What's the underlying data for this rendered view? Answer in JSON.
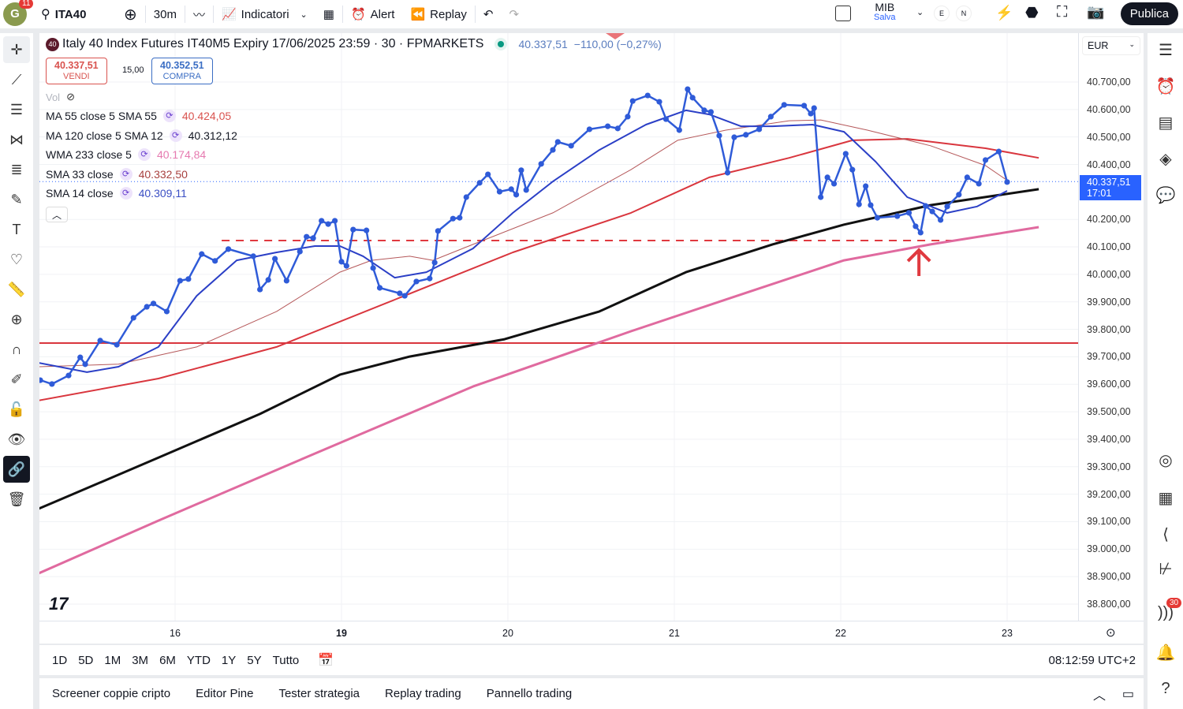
{
  "topbar": {
    "notifications": "11",
    "avatar_letter": "G",
    "symbol": "ITA40",
    "interval": "30m",
    "indicators": "Indicatori",
    "alert": "Alert",
    "replay": "Replay",
    "layout_name": "MIB",
    "layout_status": "Salva",
    "e_label": "E",
    "n_label": "N",
    "publish": "Publica"
  },
  "header": {
    "symbol_badge": "40",
    "title": "Italy 40 Index Futures IT40M5 Expiry 17/06/2025 23:59 · 30 · FPMARKETS",
    "last": "40.337,51",
    "change": "−110,00 (−0,27%)",
    "sell_price": "40.337,51",
    "sell_label": "VENDI",
    "spread": "15,00",
    "buy_price": "40.352,51",
    "buy_label": "COMPRA",
    "vol": "Vol"
  },
  "legend": [
    {
      "name": "MA 55 close 5 SMA 55",
      "value": "40.424,05",
      "color": "#d9534f"
    },
    {
      "name": "MA 120 close 5 SMA 12",
      "value": "40.312,12",
      "color": "#131722"
    },
    {
      "name": "WMA 233 close 5",
      "value": "40.174,84",
      "color": "#e67ab0"
    },
    {
      "name": "SMA 33 close",
      "value": "40.332,50",
      "color": "#a8413f"
    },
    {
      "name": "SMA 14 close",
      "value": "40.309,11",
      "color": "#3b4fc4"
    }
  ],
  "price_axis": {
    "currency": "EUR",
    "labels": [
      "40.700,00",
      "40.600,00",
      "40.500,00",
      "40.400,00",
      "40.200,00",
      "40.100,00",
      "40.000,00",
      "39.900,00",
      "39.800,00",
      "39.700,00",
      "39.600,00",
      "39.500,00",
      "39.400,00",
      "39.300,00",
      "39.200,00",
      "39.100,00",
      "39.000,00",
      "38.900,00",
      "38.800,00"
    ],
    "current_price": "40.337,51",
    "countdown": "17:01"
  },
  "time_axis": {
    "labels": [
      "16",
      "19",
      "20",
      "21",
      "22",
      "23"
    ]
  },
  "ranges": [
    "1D",
    "5D",
    "1M",
    "3M",
    "6M",
    "YTD",
    "1Y",
    "5Y",
    "Tutto"
  ],
  "clock": "08:12:59 UTC+2",
  "bottom_tabs": [
    "Screener coppie cripto",
    "Editor Pine",
    "Tester strategia",
    "Replay trading",
    "Pannello trading"
  ],
  "right_badge": "30",
  "chart_data": {
    "type": "line",
    "x_unit": "trading days offset from '16' label (16=0,19=1,20=2,21=3,22=4,23=5)",
    "ylim": [
      38750,
      40750
    ],
    "price": {
      "name": "ITA40 close",
      "color": "#2f5bd8",
      "points": [
        [
          -0.81,
          39615
        ],
        [
          -0.74,
          39601
        ],
        [
          -0.64,
          39632
        ],
        [
          -0.57,
          39698
        ],
        [
          -0.54,
          39673
        ],
        [
          -0.45,
          39759
        ],
        [
          -0.35,
          39744
        ],
        [
          -0.25,
          39842
        ],
        [
          -0.17,
          39882
        ],
        [
          -0.13,
          39894
        ],
        [
          -0.05,
          39865
        ],
        [
          0.03,
          39977
        ],
        [
          0.08,
          39983
        ],
        [
          0.16,
          40074
        ],
        [
          0.24,
          40049
        ],
        [
          0.32,
          40092
        ],
        [
          0.47,
          40066
        ],
        [
          0.51,
          39945
        ],
        [
          0.56,
          39980
        ],
        [
          0.6,
          40057
        ],
        [
          0.67,
          39977
        ],
        [
          0.75,
          40083
        ],
        [
          0.79,
          40137
        ],
        [
          0.83,
          40132
        ],
        [
          0.88,
          40195
        ],
        [
          0.92,
          40183
        ],
        [
          0.96,
          40195
        ],
        [
          1.0,
          40046
        ],
        [
          1.03,
          40031
        ],
        [
          1.07,
          40163
        ],
        [
          1.15,
          40160
        ],
        [
          1.19,
          40023
        ],
        [
          1.23,
          39951
        ],
        [
          1.35,
          39931
        ],
        [
          1.38,
          39922
        ],
        [
          1.45,
          39974
        ],
        [
          1.53,
          39985
        ],
        [
          1.56,
          40043
        ],
        [
          1.58,
          40158
        ],
        [
          1.67,
          40203
        ],
        [
          1.71,
          40206
        ],
        [
          1.75,
          40281
        ],
        [
          1.83,
          40333
        ],
        [
          1.88,
          40364
        ],
        [
          1.95,
          40301
        ],
        [
          2.02,
          40310
        ],
        [
          2.05,
          40290
        ],
        [
          2.08,
          40379
        ],
        [
          2.11,
          40307
        ],
        [
          2.2,
          40402
        ],
        [
          2.27,
          40453
        ],
        [
          2.3,
          40482
        ],
        [
          2.38,
          40468
        ],
        [
          2.49,
          40528
        ],
        [
          2.6,
          40539
        ],
        [
          2.66,
          40531
        ],
        [
          2.72,
          40574
        ],
        [
          2.75,
          40631
        ],
        [
          2.84,
          40651
        ],
        [
          2.91,
          40628
        ],
        [
          2.95,
          40565
        ],
        [
          3.03,
          40525
        ],
        [
          3.08,
          40674
        ],
        [
          3.11,
          40643
        ],
        [
          3.18,
          40597
        ],
        [
          3.22,
          40591
        ],
        [
          3.27,
          40505
        ],
        [
          3.32,
          40370
        ],
        [
          3.36,
          40499
        ],
        [
          3.43,
          40508
        ],
        [
          3.51,
          40528
        ],
        [
          3.58,
          40574
        ],
        [
          3.66,
          40617
        ],
        [
          3.78,
          40614
        ],
        [
          3.82,
          40585
        ],
        [
          3.84,
          40605
        ],
        [
          3.88,
          40281
        ],
        [
          3.92,
          40353
        ],
        [
          3.96,
          40330
        ],
        [
          4.03,
          40439
        ],
        [
          4.07,
          40381
        ],
        [
          4.11,
          40255
        ],
        [
          4.15,
          40321
        ],
        [
          4.18,
          40252
        ],
        [
          4.22,
          40206
        ],
        [
          4.34,
          40212
        ],
        [
          4.41,
          40224
        ],
        [
          4.45,
          40175
        ],
        [
          4.48,
          40152
        ],
        [
          4.51,
          40249
        ],
        [
          4.55,
          40229
        ],
        [
          4.6,
          40198
        ],
        [
          4.64,
          40247
        ],
        [
          4.71,
          40290
        ],
        [
          4.76,
          40353
        ],
        [
          4.83,
          40330
        ],
        [
          4.87,
          40416
        ],
        [
          4.95,
          40447
        ],
        [
          5.0,
          40336
        ]
      ]
    },
    "series": [
      {
        "name": "MA 120 (black)",
        "color": "#111111",
        "width": 3,
        "points": [
          [
            -0.82,
            39147
          ],
          [
            -0.1,
            39333
          ],
          [
            0.51,
            39492
          ],
          [
            0.99,
            39635
          ],
          [
            1.41,
            39701
          ],
          [
            1.98,
            39764
          ],
          [
            2.55,
            39865
          ],
          [
            3.07,
            40008
          ],
          [
            3.59,
            40109
          ],
          [
            4.02,
            40181
          ],
          [
            4.54,
            40252
          ],
          [
            5.19,
            40310
          ]
        ]
      },
      {
        "name": "WMA 233",
        "color": "#e06a9f",
        "width": 3,
        "points": [
          [
            -0.82,
            38912
          ],
          [
            -0.1,
            39104
          ],
          [
            0.84,
            39348
          ],
          [
            1.79,
            39592
          ],
          [
            2.74,
            39793
          ],
          [
            3.45,
            39937
          ],
          [
            4.02,
            40051
          ],
          [
            4.54,
            40109
          ],
          [
            5.19,
            40172
          ]
        ]
      },
      {
        "name": "MA 55",
        "color": "#d9363e",
        "width": 2,
        "points": [
          [
            -0.82,
            39541
          ],
          [
            -0.1,
            39621
          ],
          [
            0.61,
            39736
          ],
          [
            1.32,
            39908
          ],
          [
            2.03,
            40080
          ],
          [
            2.74,
            40224
          ],
          [
            3.21,
            40353
          ],
          [
            3.69,
            40424
          ],
          [
            4.07,
            40488
          ],
          [
            4.4,
            40493
          ],
          [
            4.87,
            40459
          ],
          [
            5.19,
            40424
          ]
        ]
      },
      {
        "name": "SMA 33",
        "color": "#b5585a",
        "width": 1,
        "points": [
          [
            -0.82,
            39664
          ],
          [
            -0.34,
            39673
          ],
          [
            0.13,
            39736
          ],
          [
            0.61,
            39865
          ],
          [
            0.99,
            40008
          ],
          [
            1.18,
            40051
          ],
          [
            1.41,
            40066
          ],
          [
            1.55,
            40051
          ],
          [
            1.79,
            40109
          ],
          [
            2.27,
            40224
          ],
          [
            2.74,
            40381
          ],
          [
            3.02,
            40488
          ],
          [
            3.31,
            40525
          ],
          [
            3.69,
            40559
          ],
          [
            3.88,
            40562
          ],
          [
            4.16,
            40525
          ],
          [
            4.54,
            40468
          ],
          [
            4.87,
            40396
          ],
          [
            5.01,
            40338
          ]
        ]
      },
      {
        "name": "SMA 14",
        "color": "#2b3fc6",
        "width": 2,
        "points": [
          [
            -0.82,
            39678
          ],
          [
            -0.53,
            39644
          ],
          [
            -0.34,
            39664
          ],
          [
            -0.1,
            39736
          ],
          [
            0.13,
            39922
          ],
          [
            0.37,
            40051
          ],
          [
            0.61,
            40080
          ],
          [
            0.84,
            40103
          ],
          [
            0.99,
            40103
          ],
          [
            1.13,
            40066
          ],
          [
            1.32,
            39988
          ],
          [
            1.51,
            40008
          ],
          [
            1.79,
            40094
          ],
          [
            2.03,
            40224
          ],
          [
            2.27,
            40338
          ],
          [
            2.55,
            40453
          ],
          [
            2.83,
            40545
          ],
          [
            3.07,
            40597
          ],
          [
            3.21,
            40582
          ],
          [
            3.4,
            40539
          ],
          [
            3.59,
            40539
          ],
          [
            3.83,
            40545
          ],
          [
            4.02,
            40519
          ],
          [
            4.21,
            40410
          ],
          [
            4.4,
            40281
          ],
          [
            4.64,
            40224
          ],
          [
            4.82,
            40247
          ],
          [
            5.0,
            40304
          ]
        ]
      }
    ],
    "annotations": {
      "horizontal_line": 39750,
      "dashed_line": {
        "price": 40123,
        "from": 0.28,
        "to": 4.71
      },
      "up_arrow_at": 4.47,
      "current_price": 40337.51
    }
  }
}
